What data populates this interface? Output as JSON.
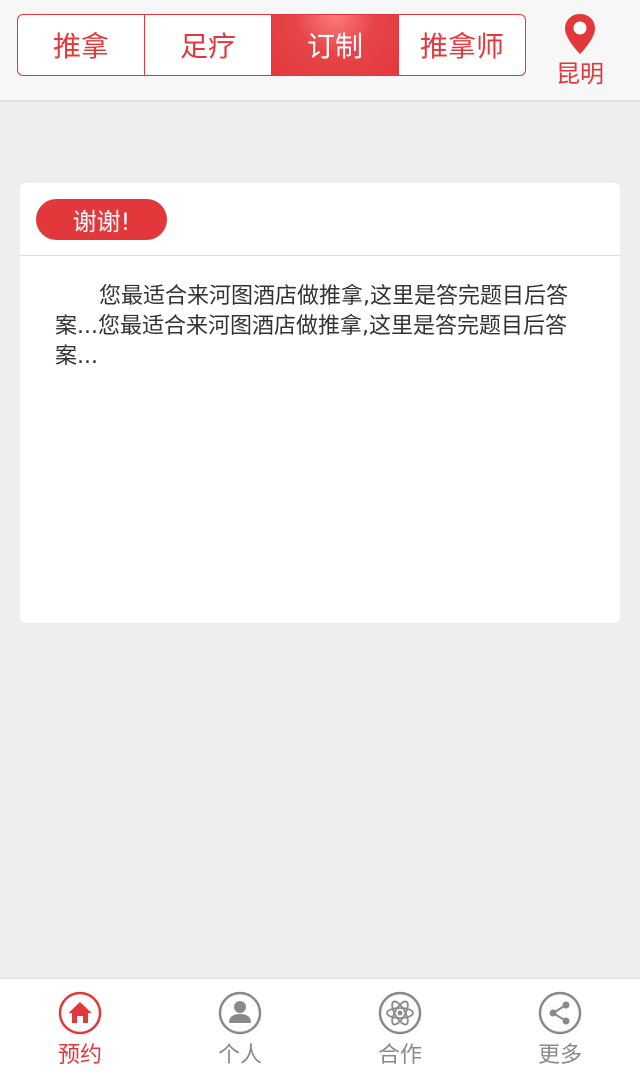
{
  "colors": {
    "accent": "#e3383b",
    "background": "#eeeeee",
    "inactive": "#8a8a8a"
  },
  "header": {
    "tabs": [
      {
        "label": "推拿",
        "active": false
      },
      {
        "label": "足疗",
        "active": false
      },
      {
        "label": "订制",
        "active": true
      },
      {
        "label": "推拿师",
        "active": false
      }
    ],
    "location": {
      "icon": "location-pin-icon",
      "city": "昆明"
    }
  },
  "card": {
    "badge": "谢谢!",
    "body": "您最适合来河图酒店做推拿,这里是答完题目后答案...您最适合来河图酒店做推拿,这里是答完题目后答案..."
  },
  "tabbar": {
    "items": [
      {
        "label": "预约",
        "icon": "home-icon",
        "active": true
      },
      {
        "label": "个人",
        "icon": "user-icon",
        "active": false
      },
      {
        "label": "合作",
        "icon": "atom-icon",
        "active": false
      },
      {
        "label": "更多",
        "icon": "share-icon",
        "active": false
      }
    ]
  }
}
